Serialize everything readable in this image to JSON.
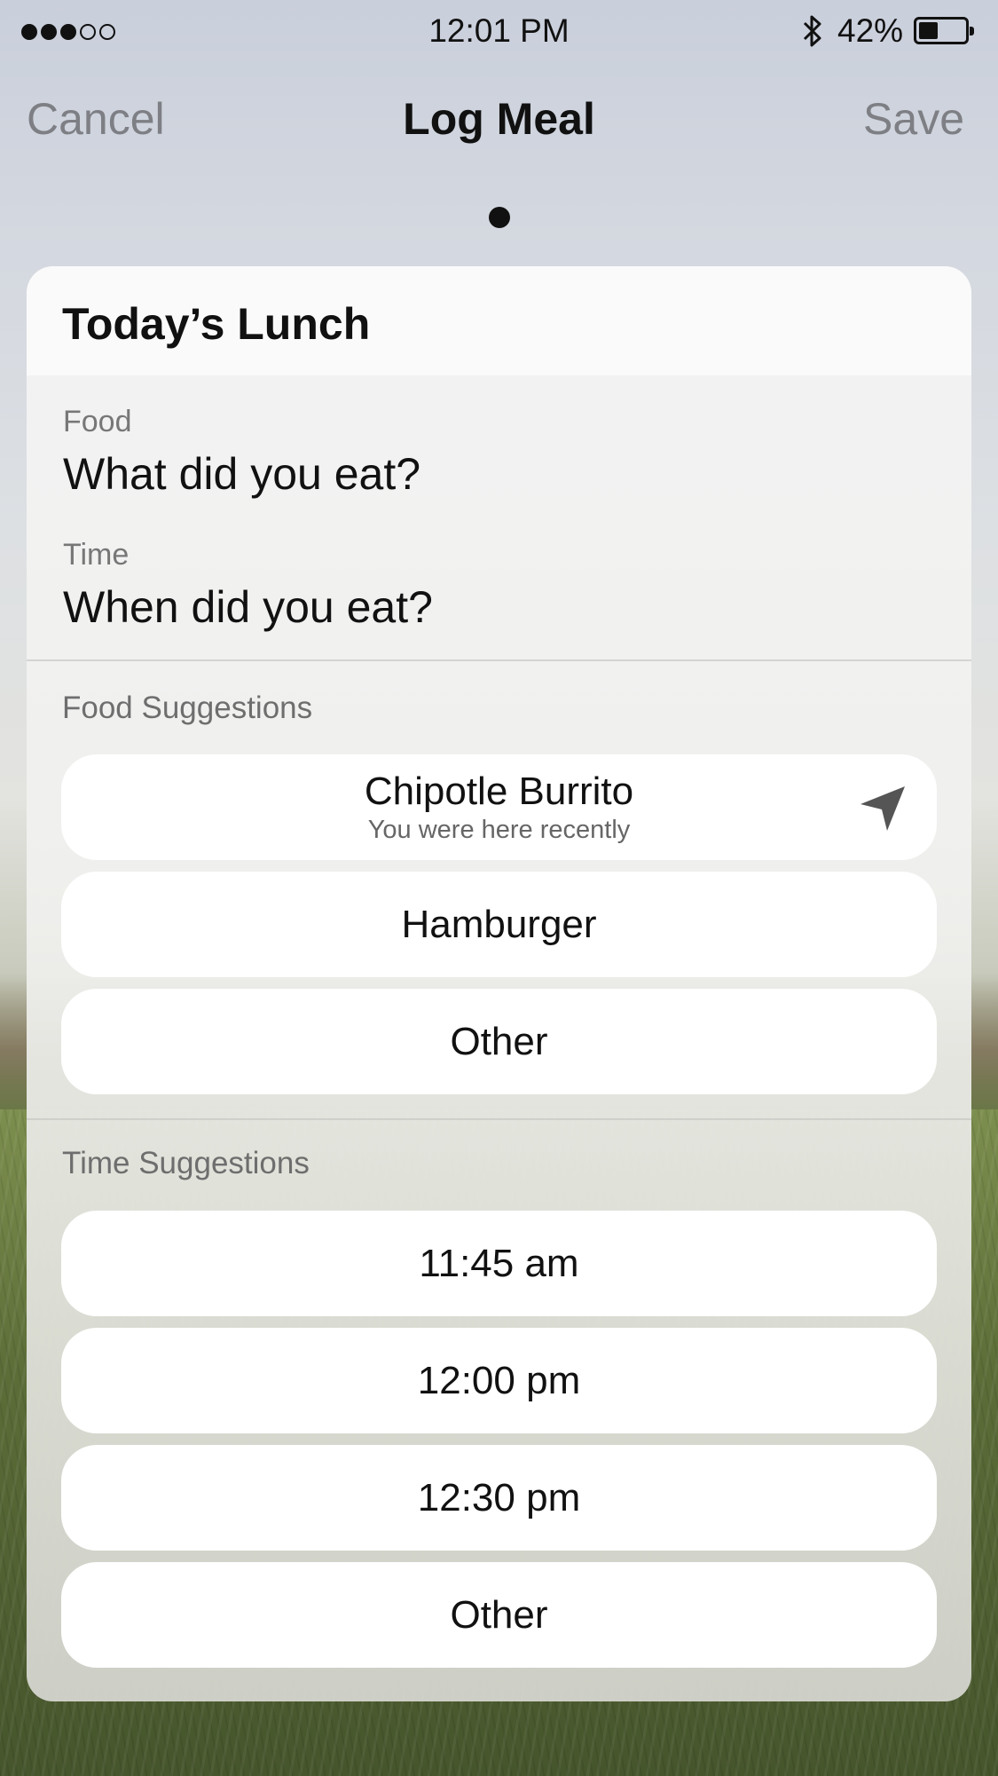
{
  "status_bar": {
    "signal_dots": [
      true,
      true,
      true,
      false,
      false
    ],
    "time": "12:01 PM",
    "battery_percent": "42%",
    "battery_level": 0.42
  },
  "nav": {
    "cancel_label": "Cancel",
    "title": "Log Meal",
    "save_label": "Save"
  },
  "card": {
    "title": "Today’s Lunch",
    "food": {
      "label": "Food",
      "placeholder": "What did you eat?"
    },
    "time": {
      "label": "Time",
      "placeholder": "When did you eat?"
    },
    "food_suggestions": {
      "title": "Food Suggestions",
      "items": [
        {
          "label": "Chipotle Burrito",
          "subtitle": "You were here recently",
          "icon": "location-arrow-icon"
        },
        {
          "label": "Hamburger"
        },
        {
          "label": "Other"
        }
      ]
    },
    "time_suggestions": {
      "title": "Time Suggestions",
      "items": [
        {
          "label": "11:45 am"
        },
        {
          "label": "12:00 pm"
        },
        {
          "label": "12:30 pm"
        },
        {
          "label": "Other"
        }
      ]
    }
  },
  "colors": {
    "accent_text": "#111111",
    "nav_inactive": "#7d7f84",
    "pill_background": "#ffffff"
  }
}
